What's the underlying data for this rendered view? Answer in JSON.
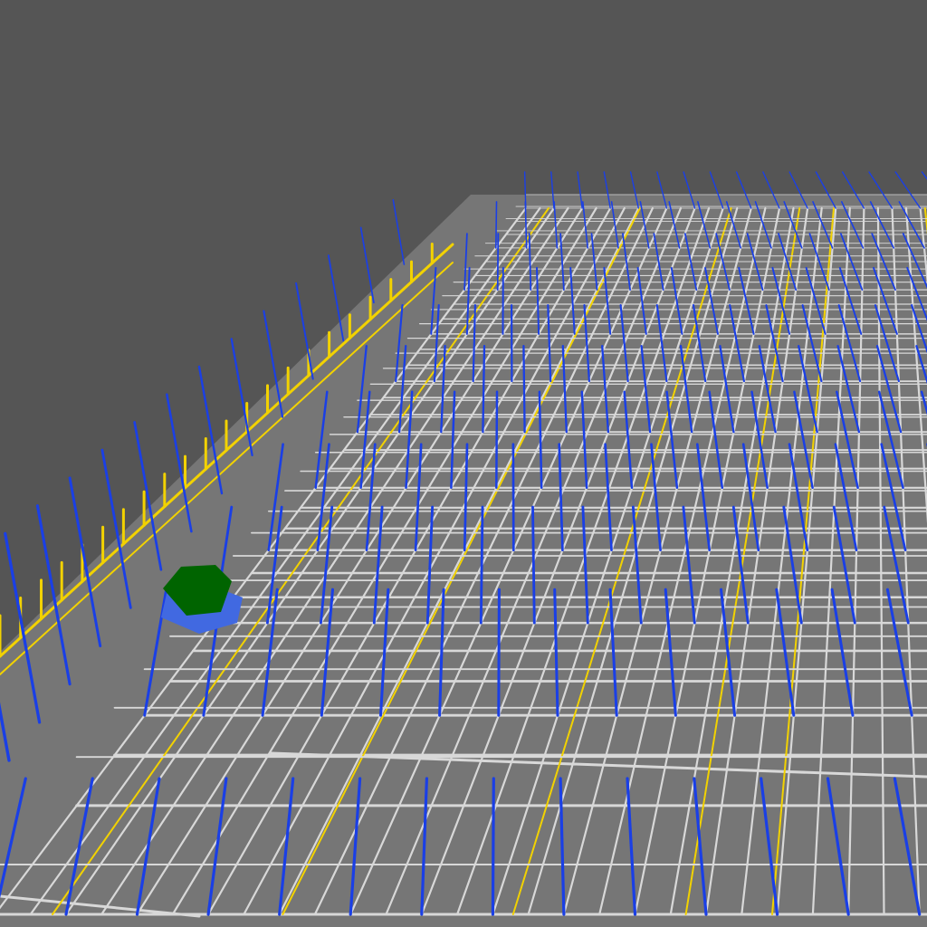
{
  "scene": {
    "view": "3d-perspective",
    "description_free": true,
    "colors": {
      "sky": "#555555",
      "ground": "#767676",
      "floor_grid": "#d8d8d8",
      "aisle_line": "#f2d200",
      "pillar": "#1a3fe6",
      "pillar_light": "#5a80f0",
      "actor_top": "#006400",
      "actor_base": "#4169e1"
    },
    "actor": {
      "type": "hexagonal-prism",
      "top_color": "#006400",
      "base_color": "#4169e1"
    },
    "grid_front_edge_visible": true,
    "pillar_style": "vertical-lines",
    "aisle_markings": "yellow-lines"
  }
}
